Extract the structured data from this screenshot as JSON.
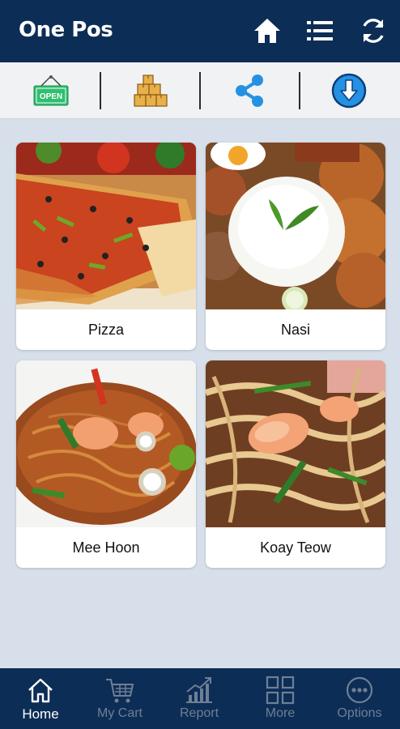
{
  "app": {
    "title": "One Pos"
  },
  "header_actions": [
    {
      "icon": "home-icon"
    },
    {
      "icon": "list-icon"
    },
    {
      "icon": "sync-icon"
    }
  ],
  "toolbar": {
    "open_sign_text": "OPEN",
    "items": [
      {
        "icon": "open-sign-icon"
      },
      {
        "icon": "boxes-icon"
      },
      {
        "icon": "share-icon"
      },
      {
        "icon": "download-icon"
      }
    ]
  },
  "categories": [
    {
      "name": "Pizza"
    },
    {
      "name": "Nasi"
    },
    {
      "name": "Mee Hoon"
    },
    {
      "name": "Koay Teow"
    }
  ],
  "bottom_nav": {
    "items": [
      {
        "label": "Home",
        "icon": "home-icon",
        "active": true
      },
      {
        "label": "My Cart",
        "icon": "cart-icon",
        "active": false
      },
      {
        "label": "Report",
        "icon": "report-chart-icon",
        "active": false
      },
      {
        "label": "More",
        "icon": "grid-icon",
        "active": false
      },
      {
        "label": "Options",
        "icon": "ellipsis-circle-icon",
        "active": false
      }
    ]
  },
  "colors": {
    "primary": "#0c2d55",
    "background": "#d7e0ea",
    "toolbar": "#f1f2f3",
    "open_sign": "#2fbf71",
    "share_blue": "#2591e3",
    "inactive_nav": "#6e7f96"
  }
}
